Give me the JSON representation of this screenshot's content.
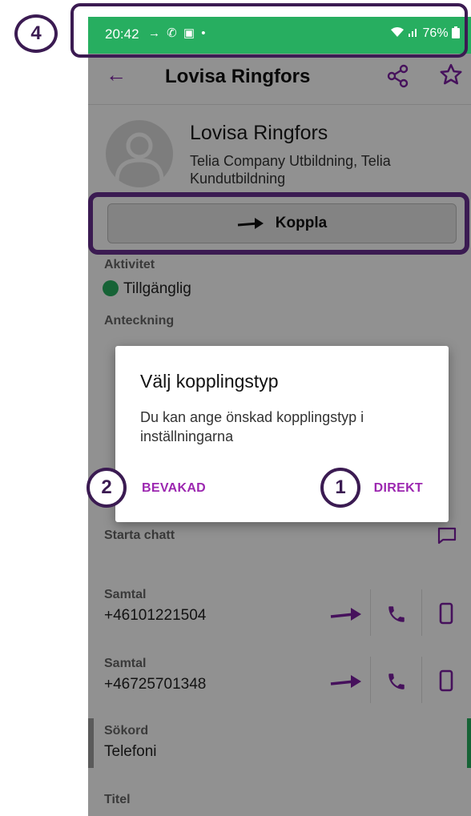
{
  "status_bar": {
    "time": "20:42",
    "left_icons": "→ ✆ ▣ •",
    "battery": "76%",
    "bg_color": "#27ae60"
  },
  "app_bar": {
    "title": "Lovisa Ringfors",
    "back_icon": "arrow-left",
    "share_icon": "share",
    "star_icon": "star-outline"
  },
  "contact": {
    "name": "Lovisa Ringfors",
    "organization": "Telia Company Utbildning, Telia Kundutbildning"
  },
  "koppla_button": {
    "label": "Koppla",
    "icon": "arrow-right"
  },
  "fields": {
    "aktivitet_label": "Aktivitet",
    "aktivitet_value": "Tillgänglig",
    "status_color": "#27ae60",
    "anteckning_label": "Anteckning",
    "starta_chatt_label": "Starta chatt",
    "samtal_1_label": "Samtal",
    "samtal_1_number": "+46101221504",
    "samtal_2_label": "Samtal",
    "samtal_2_number": "+46725701348",
    "sokord_label": "Sökord",
    "sokord_value": "Telefoni",
    "titel_label": "Titel"
  },
  "dialog": {
    "title": "Välj kopplingstyp",
    "message": "Du kan ange önskad kopplingstyp i inställningarna",
    "cancel_label": "BEVAKAD",
    "confirm_label": "DIREKT",
    "accent_color": "#9c27b0"
  },
  "annotations": {
    "marker_1": "1",
    "marker_2": "2",
    "marker_4": "4",
    "marker_color": "#3b1b52"
  },
  "accent_color": "#7b1fa2"
}
